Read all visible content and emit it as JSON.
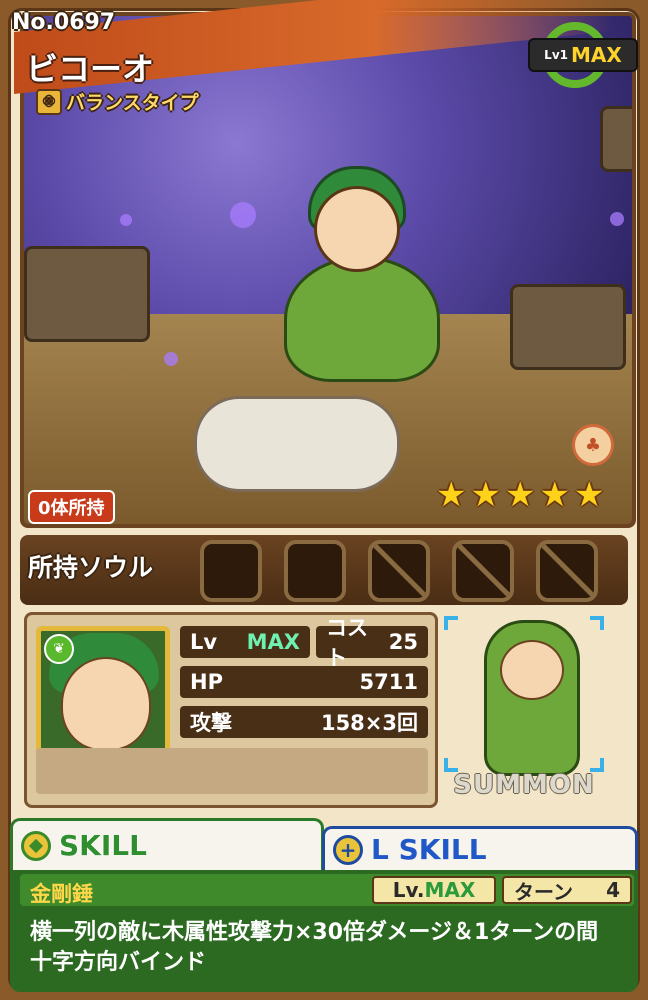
{
  "card": {
    "number": "No.0697",
    "name": "ビコーオ",
    "type_label": "バランスタイプ",
    "level_badge": {
      "lv": "Lv1",
      "max": "MAX"
    },
    "owned_count": "0体所持",
    "stars": [
      "★",
      "★",
      "★",
      "★",
      "★"
    ],
    "element": "wood",
    "colors": {
      "accent_green": "#3f8a2a",
      "lskill_blue": "#2058c8",
      "star": "#ffd21a"
    }
  },
  "soul": {
    "label": "所持ソウル",
    "slots": [
      "empty",
      "empty",
      "locked",
      "locked",
      "locked"
    ]
  },
  "stats": {
    "lv_label": "Lv",
    "lv_value": "MAX",
    "cost_label": "コスト",
    "cost_value": "25",
    "hp_label": "HP",
    "hp_value": "5711",
    "atk_label": "攻撃",
    "atk_value": "158×3回"
  },
  "summon": {
    "label": "SUMMON"
  },
  "skill": {
    "tab_label": "SKILL",
    "lskill_tab_label": "L SKILL",
    "name": "金剛錘",
    "lv_prefix": "Lv.",
    "lv_value": "MAX",
    "turn_label": "ターン",
    "turn_value": "4",
    "description": "横一列の敵に木属性攻撃力×30倍ダメージ＆1ターンの間十字方向バインド"
  }
}
